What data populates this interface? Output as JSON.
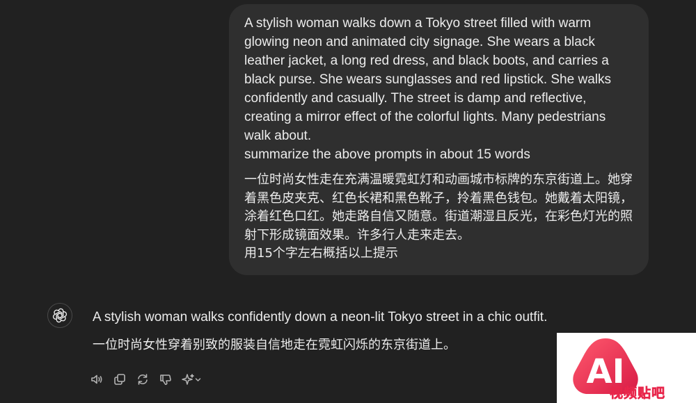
{
  "user_message": {
    "en_lines": [
      "A stylish woman walks down a Tokyo street filled with warm",
      "glowing neon and animated city signage. She wears a black",
      "leather jacket, a long red dress, and black boots, and carries a",
      "black purse. She wears sunglasses and red lipstick. She walks",
      "confidently and casually. The street is damp and reflective,",
      "creating a mirror effect of the colorful lights. Many pedestrians",
      "walk about.",
      "summarize the above prompts in about 15 words"
    ],
    "zh_lines": [
      "一位时尚女性走在充满温暖霓虹灯和动画城市标牌的东京街道上。她穿",
      "着黑色皮夹克、红色长裙和黑色靴子，拎着黑色钱包。她戴着太阳镜，",
      "涂着红色口红。她走路自信又随意。街道潮湿且反光，在彩色灯光的照",
      "射下形成镜面效果。许多行人走来走去。",
      "用15个字左右概括以上提示"
    ]
  },
  "assistant_message": {
    "avatar_icon": "openai-logo-icon",
    "en": "A stylish woman walks confidently down a neon-lit Tokyo street in a chic outfit.",
    "zh": "一位时尚女性穿着别致的服装自信地走在霓虹闪烁的东京街道上。"
  },
  "actions": [
    {
      "name": "read-aloud-button",
      "icon": "speaker-icon"
    },
    {
      "name": "copy-button",
      "icon": "copy-icon"
    },
    {
      "name": "regenerate-button",
      "icon": "refresh-icon"
    },
    {
      "name": "thumbs-down-button",
      "icon": "thumbs-down-icon"
    },
    {
      "name": "model-switch-button",
      "icon": "sparkle-chevron-icon"
    }
  ],
  "watermark": {
    "logo_text": "AI",
    "caption": "视频贴吧"
  },
  "colors": {
    "background": "#212121",
    "user_bubble": "#2f2f2f",
    "text": "#ececec",
    "icon": "#b4b4b4",
    "watermark_red": "#e8264b"
  }
}
